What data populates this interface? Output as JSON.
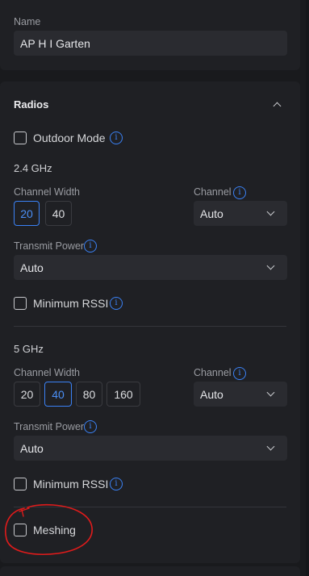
{
  "name_field": {
    "label": "Name",
    "value": "AP H I Garten"
  },
  "radios": {
    "title": "Radios",
    "outdoor_mode": {
      "label": "Outdoor Mode",
      "checked": false
    },
    "band_24": {
      "title": "2.4 GHz",
      "channel_width_label": "Channel Width",
      "widths": [
        "20",
        "40"
      ],
      "selected_width": "20",
      "channel_label": "Channel",
      "channel_value": "Auto",
      "transmit_power_label": "Transmit Power",
      "transmit_power_value": "Auto",
      "min_rssi": {
        "label": "Minimum RSSI",
        "checked": false
      }
    },
    "band_5": {
      "title": "5 GHz",
      "channel_width_label": "Channel Width",
      "widths": [
        "20",
        "40",
        "80",
        "160"
      ],
      "selected_width": "40",
      "channel_label": "Channel",
      "channel_value": "Auto",
      "transmit_power_label": "Transmit Power",
      "transmit_power_value": "Auto",
      "min_rssi": {
        "label": "Minimum RSSI",
        "checked": false
      }
    },
    "meshing": {
      "label": "Meshing",
      "checked": false
    }
  },
  "colors": {
    "accent": "#3b82f6",
    "annotation": "#e01b1b",
    "panel": "#1f2024",
    "background": "#191a1d"
  },
  "icons": {
    "info": "info-icon",
    "collapse": "chevron-up-icon",
    "dropdown": "chevron-down-icon"
  }
}
